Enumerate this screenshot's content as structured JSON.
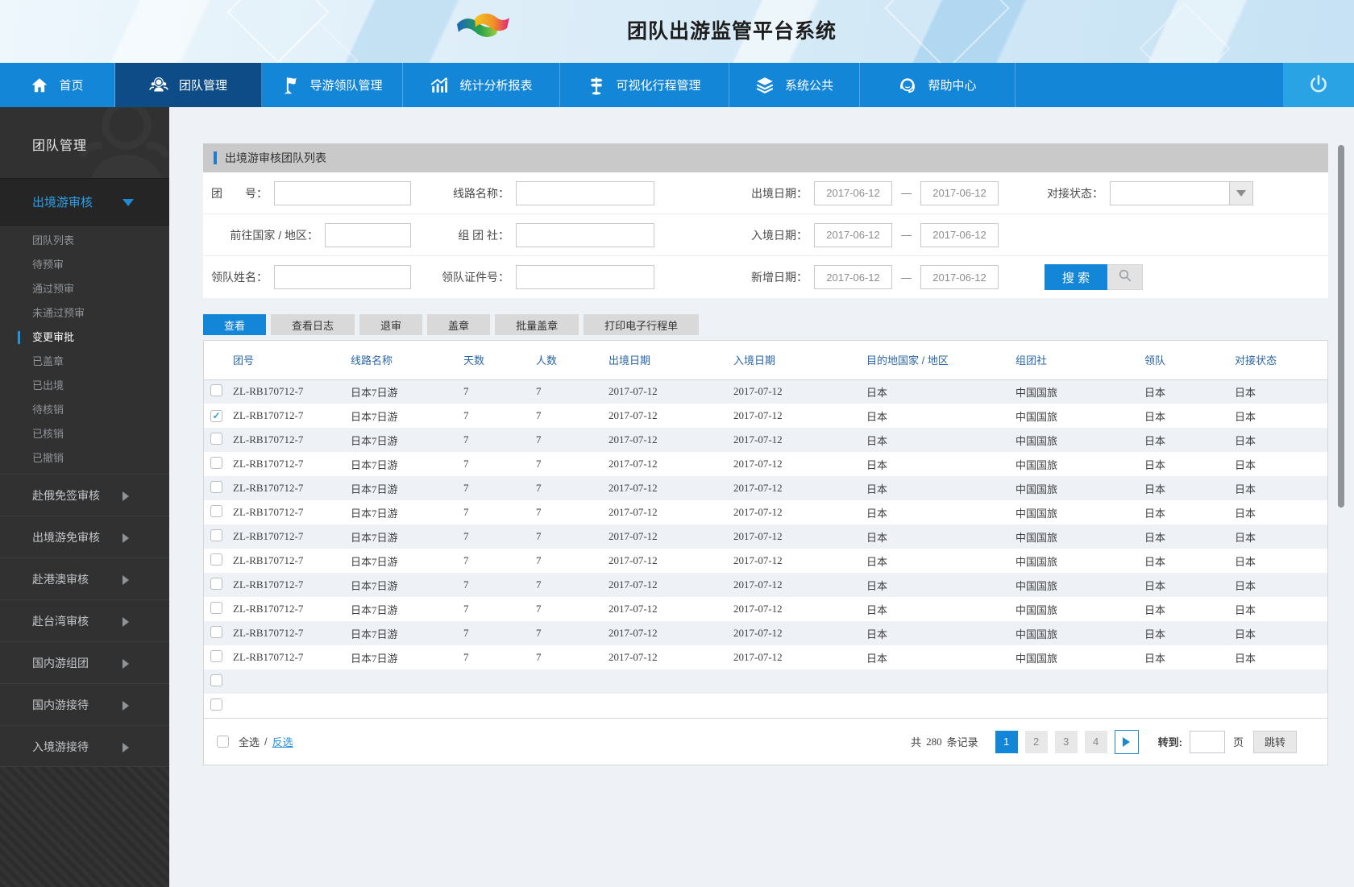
{
  "banner": {
    "title": "团队出游监管平台系统"
  },
  "nav": {
    "items": [
      {
        "label": "首页",
        "icon": "home",
        "active": false
      },
      {
        "label": "团队管理",
        "icon": "team",
        "active": true
      },
      {
        "label": "导游领队管理",
        "icon": "flag",
        "active": false
      },
      {
        "label": "统计分析报表",
        "icon": "chart",
        "active": false
      },
      {
        "label": "可视化行程管理",
        "icon": "signpost",
        "active": false
      },
      {
        "label": "系统公共",
        "icon": "layers",
        "active": false
      },
      {
        "label": "帮助中心",
        "icon": "headset",
        "active": false
      }
    ]
  },
  "sidebar": {
    "title": "团队管理",
    "expanded_group": "出境游审核",
    "sub_items": [
      "团队列表",
      "待预审",
      "通过预审",
      "未通过预审",
      "变更审批",
      "已盖章",
      "已出境",
      "待核销",
      "已核销",
      "已撤销"
    ],
    "active_sub_item": "变更审批",
    "collapsed_groups": [
      "赴俄免签审核",
      "出境游免审核",
      "赴港澳审核",
      "赴台湾审核",
      "国内游组团",
      "国内游接待",
      "入境游接待"
    ]
  },
  "search_panel": {
    "title": "出境游审核团队列表",
    "range_separator": "—",
    "fields": {
      "group_no": {
        "label": "团　　号：",
        "value": ""
      },
      "route_name": {
        "label": "线路名称：",
        "value": ""
      },
      "depart_date": {
        "label": "出境日期：",
        "from": "2017-06-12",
        "to": "2017-06-12"
      },
      "dock_status": {
        "label": "对接状态：",
        "value": ""
      },
      "dest_country": {
        "label": "前往国家 / 地区：",
        "value": ""
      },
      "agency": {
        "label": "组 团 社：",
        "value": ""
      },
      "entry_date": {
        "label": "入境日期：",
        "from": "2017-06-12",
        "to": "2017-06-12"
      },
      "leader_name": {
        "label": "领队姓名：",
        "value": ""
      },
      "leader_id": {
        "label": "领队证件号：",
        "value": ""
      },
      "added_date": {
        "label": "新增日期：",
        "from": "2017-06-12",
        "to": "2017-06-12"
      }
    },
    "search_label": "搜 索"
  },
  "toolbar": {
    "buttons": [
      "查看",
      "查看日志",
      "退审",
      "盖章",
      "批量盖章",
      "打印电子行程单"
    ],
    "active_index": 0
  },
  "table": {
    "columns": [
      "团号",
      "线路名称",
      "天数",
      "人数",
      "出境日期",
      "入境日期",
      "目的地国家 / 地区",
      "组团社",
      "领队",
      "对接状态"
    ],
    "rows": [
      {
        "checked": false,
        "cells": [
          "ZL-RB170712-7",
          "日本7日游",
          "7",
          "7",
          "2017-07-12",
          "2017-07-12",
          "日本",
          "中国国旅",
          "日本",
          "日本"
        ]
      },
      {
        "checked": true,
        "cells": [
          "ZL-RB170712-7",
          "日本7日游",
          "7",
          "7",
          "2017-07-12",
          "2017-07-12",
          "日本",
          "中国国旅",
          "日本",
          "日本"
        ]
      },
      {
        "checked": false,
        "cells": [
          "ZL-RB170712-7",
          "日本7日游",
          "7",
          "7",
          "2017-07-12",
          "2017-07-12",
          "日本",
          "中国国旅",
          "日本",
          "日本"
        ]
      },
      {
        "checked": false,
        "cells": [
          "ZL-RB170712-7",
          "日本7日游",
          "7",
          "7",
          "2017-07-12",
          "2017-07-12",
          "日本",
          "中国国旅",
          "日本",
          "日本"
        ]
      },
      {
        "checked": false,
        "cells": [
          "ZL-RB170712-7",
          "日本7日游",
          "7",
          "7",
          "2017-07-12",
          "2017-07-12",
          "日本",
          "中国国旅",
          "日本",
          "日本"
        ]
      },
      {
        "checked": false,
        "cells": [
          "ZL-RB170712-7",
          "日本7日游",
          "7",
          "7",
          "2017-07-12",
          "2017-07-12",
          "日本",
          "中国国旅",
          "日本",
          "日本"
        ]
      },
      {
        "checked": false,
        "cells": [
          "ZL-RB170712-7",
          "日本7日游",
          "7",
          "7",
          "2017-07-12",
          "2017-07-12",
          "日本",
          "中国国旅",
          "日本",
          "日本"
        ]
      },
      {
        "checked": false,
        "cells": [
          "ZL-RB170712-7",
          "日本7日游",
          "7",
          "7",
          "2017-07-12",
          "2017-07-12",
          "日本",
          "中国国旅",
          "日本",
          "日本"
        ]
      },
      {
        "checked": false,
        "cells": [
          "ZL-RB170712-7",
          "日本7日游",
          "7",
          "7",
          "2017-07-12",
          "2017-07-12",
          "日本",
          "中国国旅",
          "日本",
          "日本"
        ]
      },
      {
        "checked": false,
        "cells": [
          "ZL-RB170712-7",
          "日本7日游",
          "7",
          "7",
          "2017-07-12",
          "2017-07-12",
          "日本",
          "中国国旅",
          "日本",
          "日本"
        ]
      },
      {
        "checked": false,
        "cells": [
          "ZL-RB170712-7",
          "日本7日游",
          "7",
          "7",
          "2017-07-12",
          "2017-07-12",
          "日本",
          "中国国旅",
          "日本",
          "日本"
        ]
      },
      {
        "checked": false,
        "cells": [
          "ZL-RB170712-7",
          "日本7日游",
          "7",
          "7",
          "2017-07-12",
          "2017-07-12",
          "日本",
          "中国国旅",
          "日本",
          "日本"
        ]
      }
    ],
    "empty_rows": 2
  },
  "footer": {
    "select_all": "全选",
    "separator": "/",
    "invert_select": "反选",
    "total_prefix": "共",
    "total_count": "280",
    "total_suffix": "条记录",
    "pages": [
      "1",
      "2",
      "3",
      "4"
    ],
    "active_page": "1",
    "goto_label": "转到:",
    "page_unit": "页",
    "jump_label": "跳转"
  }
}
